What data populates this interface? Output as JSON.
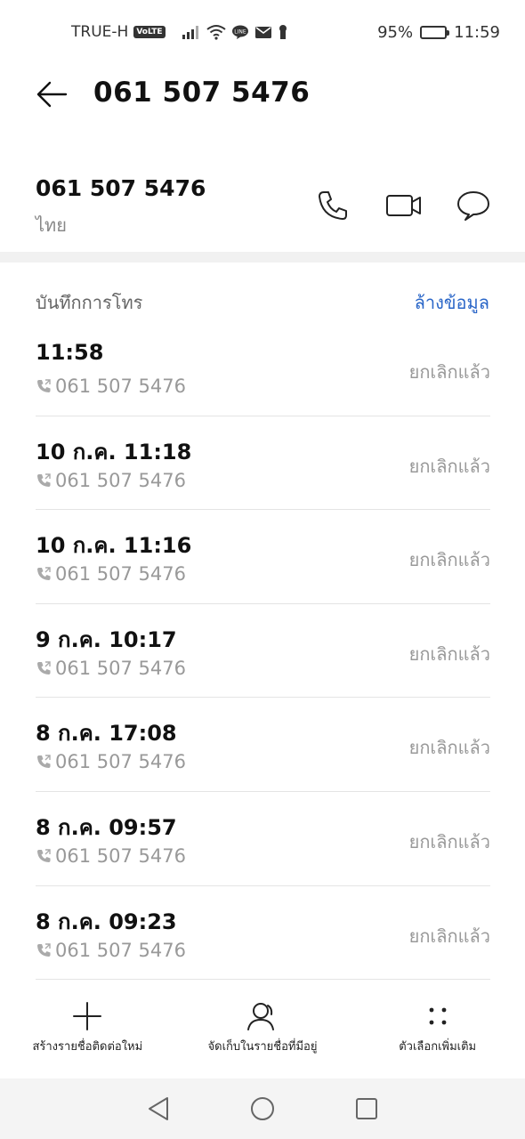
{
  "status_bar": {
    "carrier": "TRUE-H",
    "volte": "VoLTE",
    "battery": "95%",
    "battery_level": 0.95,
    "time": "11:59"
  },
  "header": {
    "title": "061 507 5476"
  },
  "contact": {
    "number": "061 507 5476",
    "location": "ไทย"
  },
  "log": {
    "title": "บันทึกการโทร",
    "clear_label": "ล้างข้อมูล",
    "items": [
      {
        "time": "11:58",
        "number": "061 507 5476",
        "status": "ยกเลิกแล้ว"
      },
      {
        "time": "10 ก.ค. 11:18",
        "number": "061 507 5476",
        "status": "ยกเลิกแล้ว"
      },
      {
        "time": "10 ก.ค. 11:16",
        "number": "061 507 5476",
        "status": "ยกเลิกแล้ว"
      },
      {
        "time": "9 ก.ค. 10:17",
        "number": "061 507 5476",
        "status": "ยกเลิกแล้ว"
      },
      {
        "time": "8 ก.ค. 17:08",
        "number": "061 507 5476",
        "status": "ยกเลิกแล้ว"
      },
      {
        "time": "8 ก.ค. 09:57",
        "number": "061 507 5476",
        "status": "ยกเลิกแล้ว"
      },
      {
        "time": "8 ก.ค. 09:23",
        "number": "061 507 5476",
        "status": "ยกเลิกแล้ว"
      }
    ]
  },
  "bottom_actions": {
    "new_contact": "สร้างรายชื่อติดต่อใหม่",
    "save_existing": "จัดเก็บในรายชื่อที่มีอยู่",
    "more_options": "ตัวเลือกเพิ่มเติม"
  },
  "colors": {
    "accent": "#2a66c8",
    "secondary_text": "#999999"
  }
}
